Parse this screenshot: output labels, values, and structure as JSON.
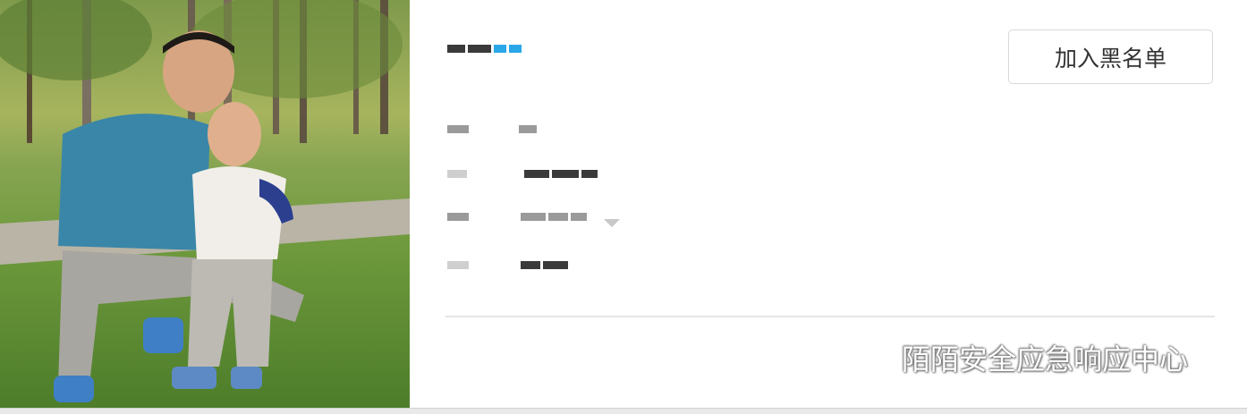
{
  "profile": {
    "photo_alt": "",
    "redacted_name": "",
    "redacted_fields": [
      "",
      "",
      "",
      ""
    ]
  },
  "actions": {
    "blacklist_label": "加入黑名单"
  },
  "watermark": {
    "text": "陌陌安全应急响应中心",
    "icon": "wechat-icon"
  },
  "colors": {
    "accent": "#2aa7e8",
    "border": "#d9d9d9",
    "divider": "#e5e5e5"
  }
}
